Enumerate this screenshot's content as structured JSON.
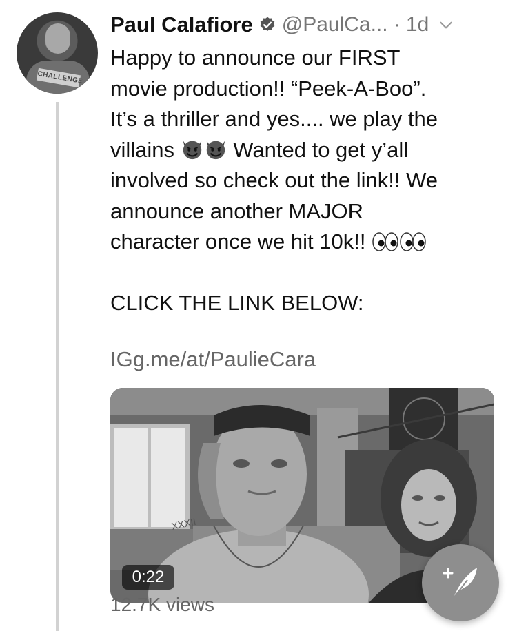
{
  "tweet": {
    "author_name": "Paul Calafiore",
    "handle": "@PaulCa...",
    "time": "· 1d",
    "avatar_badge_text": "CHALLENGE",
    "line1": "Happy to announce our FIRST",
    "line2": "movie production!! “Peek-A-Boo”.",
    "line3": "It’s a thriller and yes.... we play the",
    "line4_start": "villains",
    "line4_end": "Wanted to get y’all",
    "line5": "involved so check out the link!! We",
    "line6": "announce another MAJOR",
    "line7": "character once we hit 10k!!",
    "cta": "CLICK THE LINK BELOW:",
    "link": "IGg.me/at/PaulieCara"
  },
  "media": {
    "tattoo_text": "XXXII",
    "duration": "0:22",
    "views": "12.7K views"
  },
  "icons": {
    "verified": "verified-badge-icon",
    "chevron": "chevron-down-icon",
    "devil": "smiling-devil-emoji",
    "eyes": "eyes-emoji",
    "compose": "compose-tweet-icon"
  }
}
